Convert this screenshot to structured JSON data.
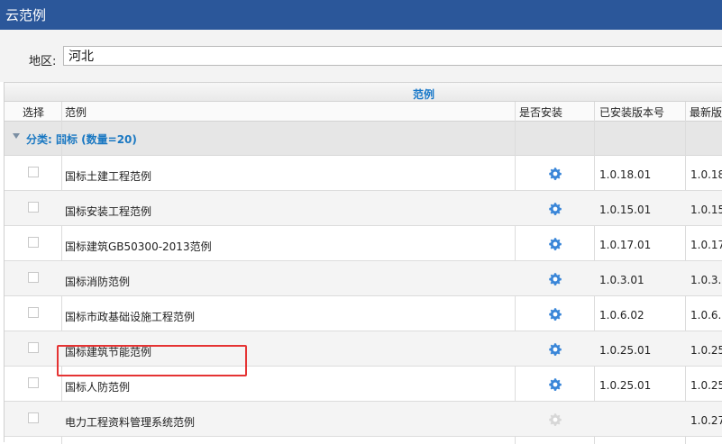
{
  "window": {
    "title": "云范例"
  },
  "filter": {
    "region_label": "地区:",
    "region_value": "河北"
  },
  "grid": {
    "band_title": "范例",
    "columns": {
      "select": "选择",
      "example": "范例",
      "installed": "是否安装",
      "installed_version": "已安装版本号",
      "latest_version": "最新版"
    },
    "group": {
      "label": "分类: 国标 (数量=20)"
    },
    "rows": [
      {
        "name": "国标土建工程范例",
        "installed_version": "1.0.18.01",
        "latest_version": "1.0.18"
      },
      {
        "name": "国标安装工程范例",
        "installed_version": "1.0.15.01",
        "latest_version": "1.0.15"
      },
      {
        "name": "国标建筑GB50300-2013范例",
        "installed_version": "1.0.17.01",
        "latest_version": "1.0.17"
      },
      {
        "name": "国标消防范例",
        "installed_version": "1.0.3.01",
        "latest_version": "1.0.3."
      },
      {
        "name": "国标市政基础设施工程范例",
        "installed_version": "1.0.6.02",
        "latest_version": "1.0.6."
      },
      {
        "name": "国标建筑节能范例",
        "installed_version": "1.0.25.01",
        "latest_version": "1.0.25"
      },
      {
        "name": "国标人防范例",
        "installed_version": "1.0.25.01",
        "latest_version": "1.0.25"
      },
      {
        "name": "电力工程资料管理系统范例",
        "installed_version": "",
        "latest_version": "1.0.27"
      }
    ]
  },
  "icons": {
    "install": "gear-icon"
  },
  "colors": {
    "title_bar": "#2b579a",
    "accent": "#1a78c2",
    "highlight": "#e53333",
    "gear": "#3a86d8"
  }
}
